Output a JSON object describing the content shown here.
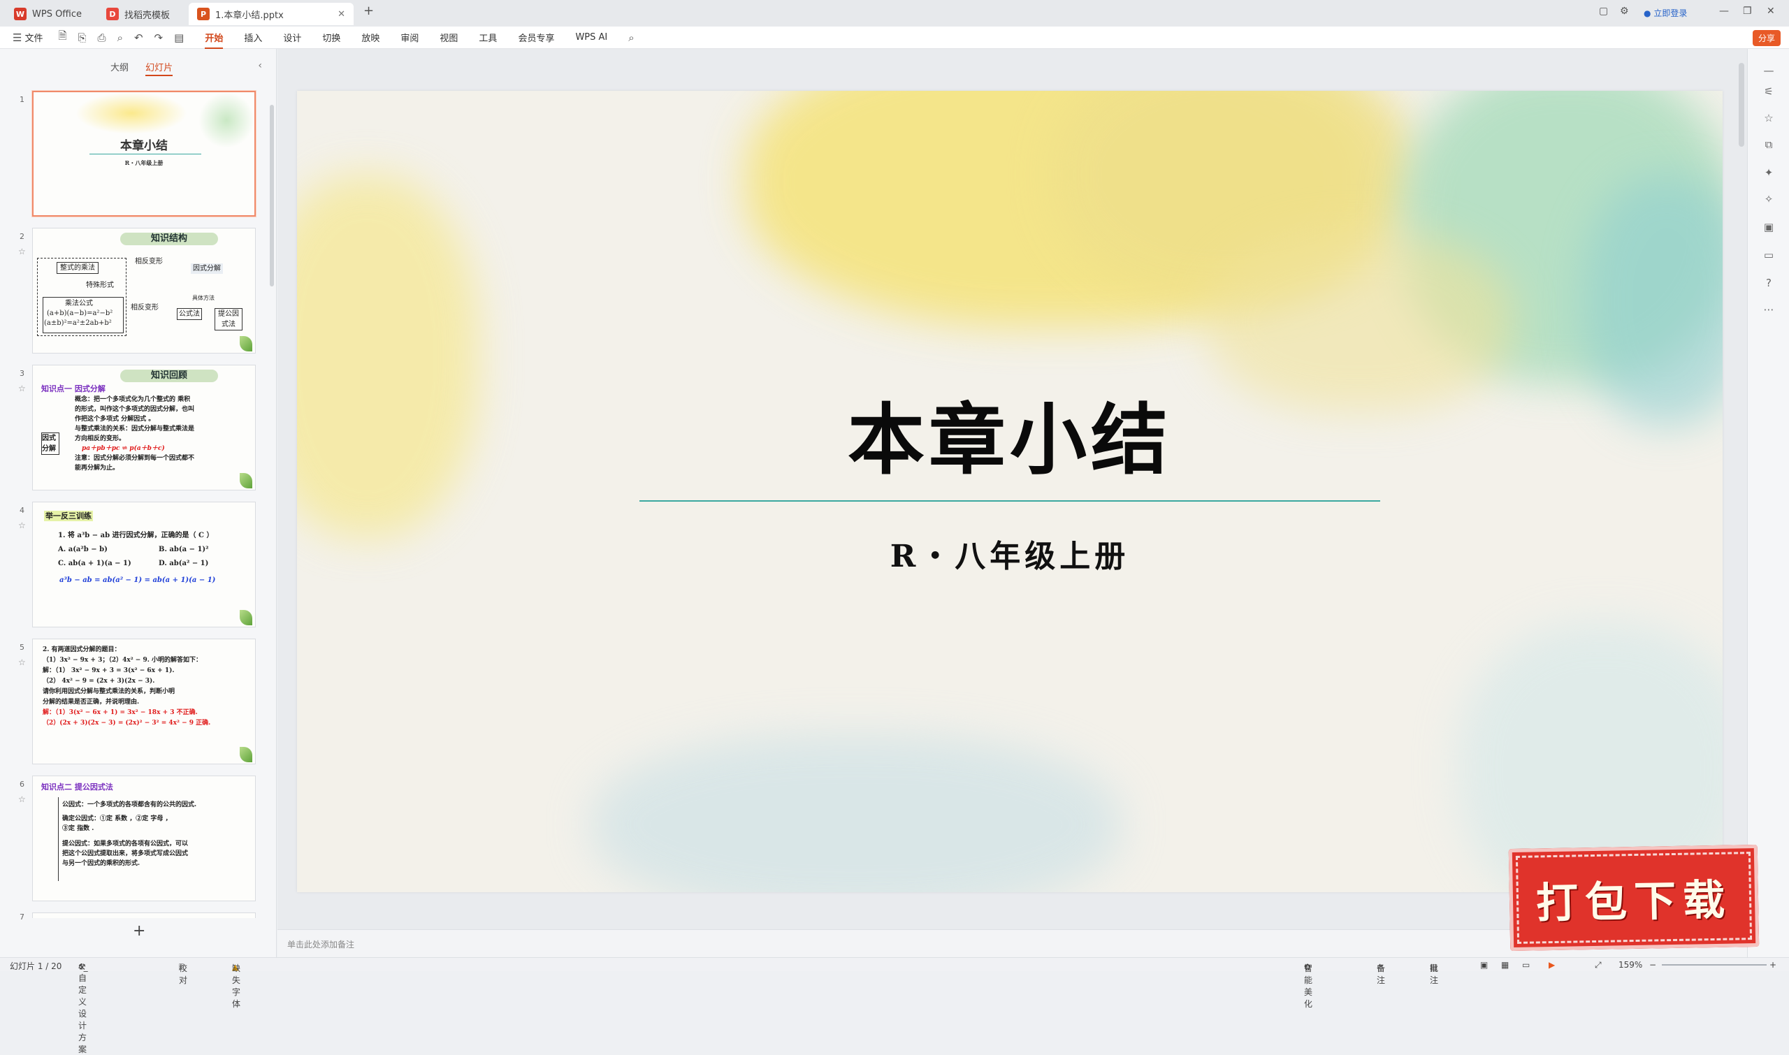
{
  "tabs": [
    {
      "label": "WPS Office",
      "logo": "W",
      "color": "#d83b2b"
    },
    {
      "label": "找稻壳模板",
      "logo": "D",
      "color": "#e8473c"
    },
    {
      "label": "1.本章小结.pptx",
      "logo": "P",
      "color": "#d9531e"
    }
  ],
  "window": {
    "login": "立即登录"
  },
  "ribbon": {
    "file": "文件",
    "items": [
      "开始",
      "插入",
      "设计",
      "切换",
      "放映",
      "审阅",
      "视图",
      "工具",
      "会员专享",
      "WPS AI"
    ],
    "share": "分享"
  },
  "left_panel": {
    "tab_outline": "大纲",
    "tab_slides": "幻灯片",
    "slides": [
      {
        "num": "1",
        "title": "本章小结",
        "subtitle": "R・八年级上册"
      },
      {
        "num": "2",
        "banner": "知识结构",
        "lines": [
          "整式的乘法",
          "相反变形",
          "因式分解",
          "特殊形式",
          "具体方法",
          "乘法公式",
          "(a+b)(a−b)=a²−b²",
          "(a±b)²=a²±2ab+b²",
          "相反变形",
          "公式法",
          "提公因式法"
        ]
      },
      {
        "num": "3",
        "banner": "知识回顾",
        "heading": "知识点一  因式分解",
        "side": "因式分解",
        "lines": [
          "概念：把一个多项式化为几个整式的 乘积",
          "的形式，叫作这个多项式的因式分解，也叫",
          "作把这个多项式 分解因式 。",
          "与整式乘法的关系：因式分解与整式乘法是",
          "方向相反的变形。",
          "pa＋pb＋pc ⇌ p(a＋b＋c)",
          "注意：因式分解必须分解到每一个因式都不",
          "能再分解为止。"
        ]
      },
      {
        "num": "4",
        "heading": "举一反三训练",
        "lines": [
          "1. 将 a³b − ab 进行因式分解，正确的是（ C ）",
          "A. a(a²b − b)",
          "B. ab(a − 1)²",
          "C. ab(a + 1)(a − 1)",
          "D. ab(a² − 1)",
          "a³b − ab = ab(a² − 1) = ab(a + 1)(a − 1)"
        ]
      },
      {
        "num": "5",
        "lines": [
          "2. 有两道因式分解的题目：",
          "（1）3x² − 9x + 3；（2）4x² − 9. 小明的解答如下：",
          "解：（1） 3x² − 9x + 3 = 3(x² − 6x + 1).",
          "（2） 4x² − 9 = (2x + 3)(2x − 3).",
          "请你利用因式分解与整式乘法的关系，判断小明",
          "分解的结果是否正确，并说明理由.",
          "解：（1）3(x² − 6x + 1) = 3x² − 18x + 3  不正确.",
          "（2）(2x + 3)(2x − 3) = (2x)² − 3² = 4x² − 9   正确."
        ]
      },
      {
        "num": "6",
        "heading": "知识点二  提公因式法",
        "lines": [
          "公因式：一个多项式的各项都含有的公共的因式.",
          "确定公因式：①定 系数 ，②定 字母 ，",
          "③定 指数 .",
          "提公因式：如果多项式的各项有公因式，可以",
          "把这个公因式提取出来，将多项式写成公因式",
          "与另一个因式的乘积的形式."
        ]
      }
    ],
    "next_num": "7"
  },
  "slide": {
    "title": "本章小结",
    "subtitle": "R・八年级上册"
  },
  "notes_placeholder": "单击此处添加备注",
  "status": {
    "slide_count": "幻灯片 1 / 20",
    "theme": "4_自定义设计方案",
    "proof": "校对",
    "missing_font": "缺失字体",
    "beautify": "智能美化",
    "notes": "备注",
    "comment": "批注",
    "zoom": "159%"
  },
  "stamp_text": "打包下载"
}
